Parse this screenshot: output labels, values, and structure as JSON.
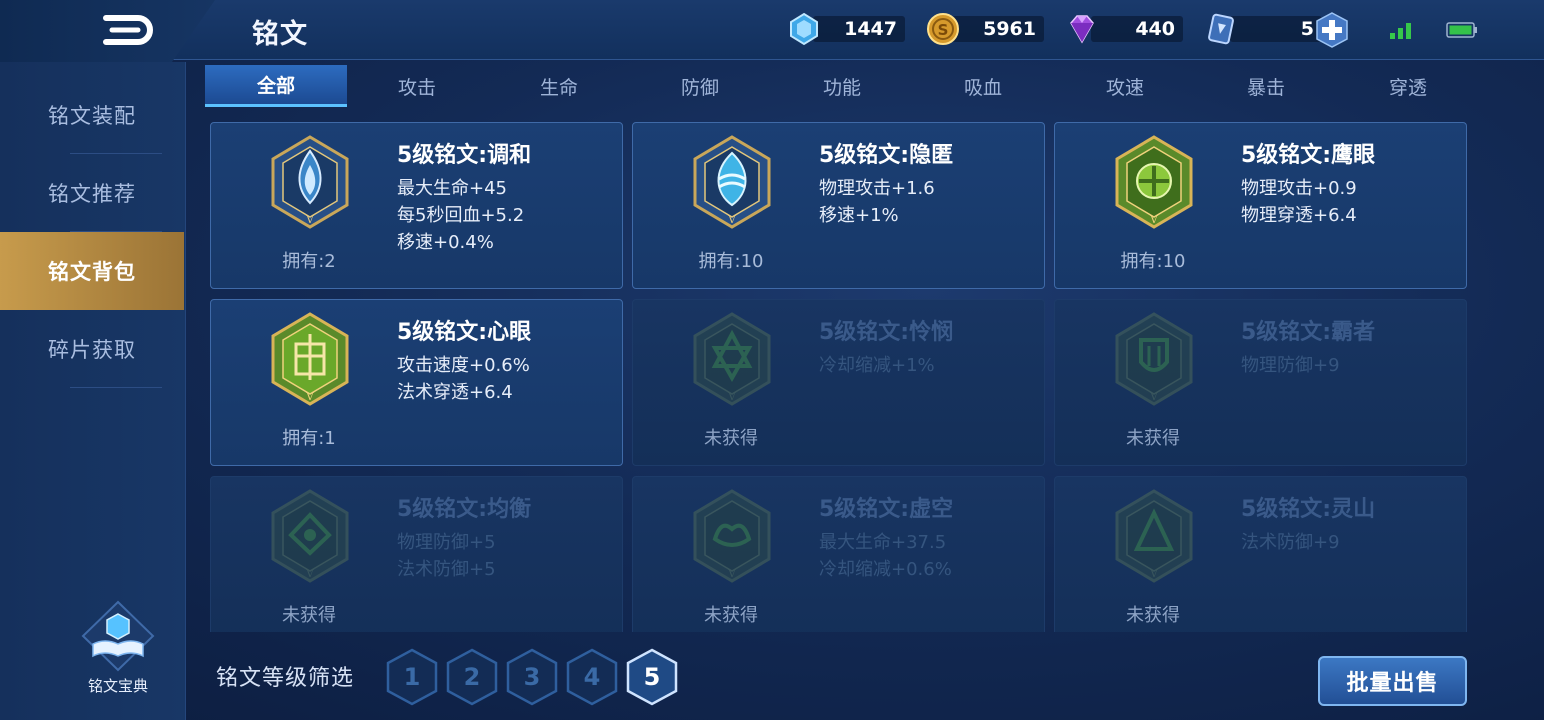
{
  "header": {
    "title": "铭文",
    "currencies": [
      {
        "icon": "ice-crystal-icon",
        "value": "1447"
      },
      {
        "icon": "gold-coin-icon",
        "value": "5961"
      },
      {
        "icon": "purple-diamond-icon",
        "value": "440"
      },
      {
        "icon": "ticket-card-icon",
        "value": "5"
      }
    ],
    "status_icons": [
      "signal-icon",
      "battery-icon"
    ]
  },
  "sidebar": {
    "items": [
      {
        "label": "铭文装配",
        "active": false
      },
      {
        "label": "铭文推荐",
        "active": false
      },
      {
        "label": "铭文背包",
        "active": true
      },
      {
        "label": "碎片获取",
        "active": false
      }
    ],
    "codex_label": "铭文宝典"
  },
  "tabs": [
    {
      "label": "全部",
      "active": true
    },
    {
      "label": "攻击",
      "active": false
    },
    {
      "label": "生命",
      "active": false
    },
    {
      "label": "防御",
      "active": false
    },
    {
      "label": "功能",
      "active": false
    },
    {
      "label": "吸血",
      "active": false
    },
    {
      "label": "攻速",
      "active": false
    },
    {
      "label": "暴击",
      "active": false
    },
    {
      "label": "穿透",
      "active": false
    }
  ],
  "runes": [
    {
      "name": "5级铭文:调和",
      "stats": [
        "最大生命+45",
        "每5秒回血+5.2",
        "移速+0.4%"
      ],
      "owned": "拥有:2",
      "locked": false,
      "color": "blue"
    },
    {
      "name": "5级铭文:隐匿",
      "stats": [
        "物理攻击+1.6",
        "移速+1%"
      ],
      "owned": "拥有:10",
      "locked": false,
      "color": "blue"
    },
    {
      "name": "5级铭文:鹰眼",
      "stats": [
        "物理攻击+0.9",
        "物理穿透+6.4"
      ],
      "owned": "拥有:10",
      "locked": false,
      "color": "green"
    },
    {
      "name": "5级铭文:心眼",
      "stats": [
        "攻击速度+0.6%",
        "法术穿透+6.4"
      ],
      "owned": "拥有:1",
      "locked": false,
      "color": "green"
    },
    {
      "name": "5级铭文:怜悯",
      "stats": [
        "冷却缩减+1%"
      ],
      "owned": "未获得",
      "locked": true,
      "color": "green"
    },
    {
      "name": "5级铭文:霸者",
      "stats": [
        "物理防御+9"
      ],
      "owned": "未获得",
      "locked": true,
      "color": "green"
    },
    {
      "name": "5级铭文:均衡",
      "stats": [
        "物理防御+5",
        "法术防御+5"
      ],
      "owned": "未获得",
      "locked": true,
      "color": "green"
    },
    {
      "name": "5级铭文:虚空",
      "stats": [
        "最大生命+37.5",
        "冷却缩减+0.6%"
      ],
      "owned": "未获得",
      "locked": true,
      "color": "green"
    },
    {
      "name": "5级铭文:灵山",
      "stats": [
        "法术防御+9"
      ],
      "owned": "未获得",
      "locked": true,
      "color": "green"
    }
  ],
  "filter": {
    "label": "铭文等级筛选",
    "levels": [
      {
        "label": "1",
        "active": false
      },
      {
        "label": "2",
        "active": false
      },
      {
        "label": "3",
        "active": false
      },
      {
        "label": "4",
        "active": false
      },
      {
        "label": "5",
        "active": true
      }
    ]
  },
  "sell_button": "批量出售",
  "colors": {
    "accent": "#5cc2ff",
    "active_side": "#c79b4c",
    "panel": "#1b3f74"
  }
}
